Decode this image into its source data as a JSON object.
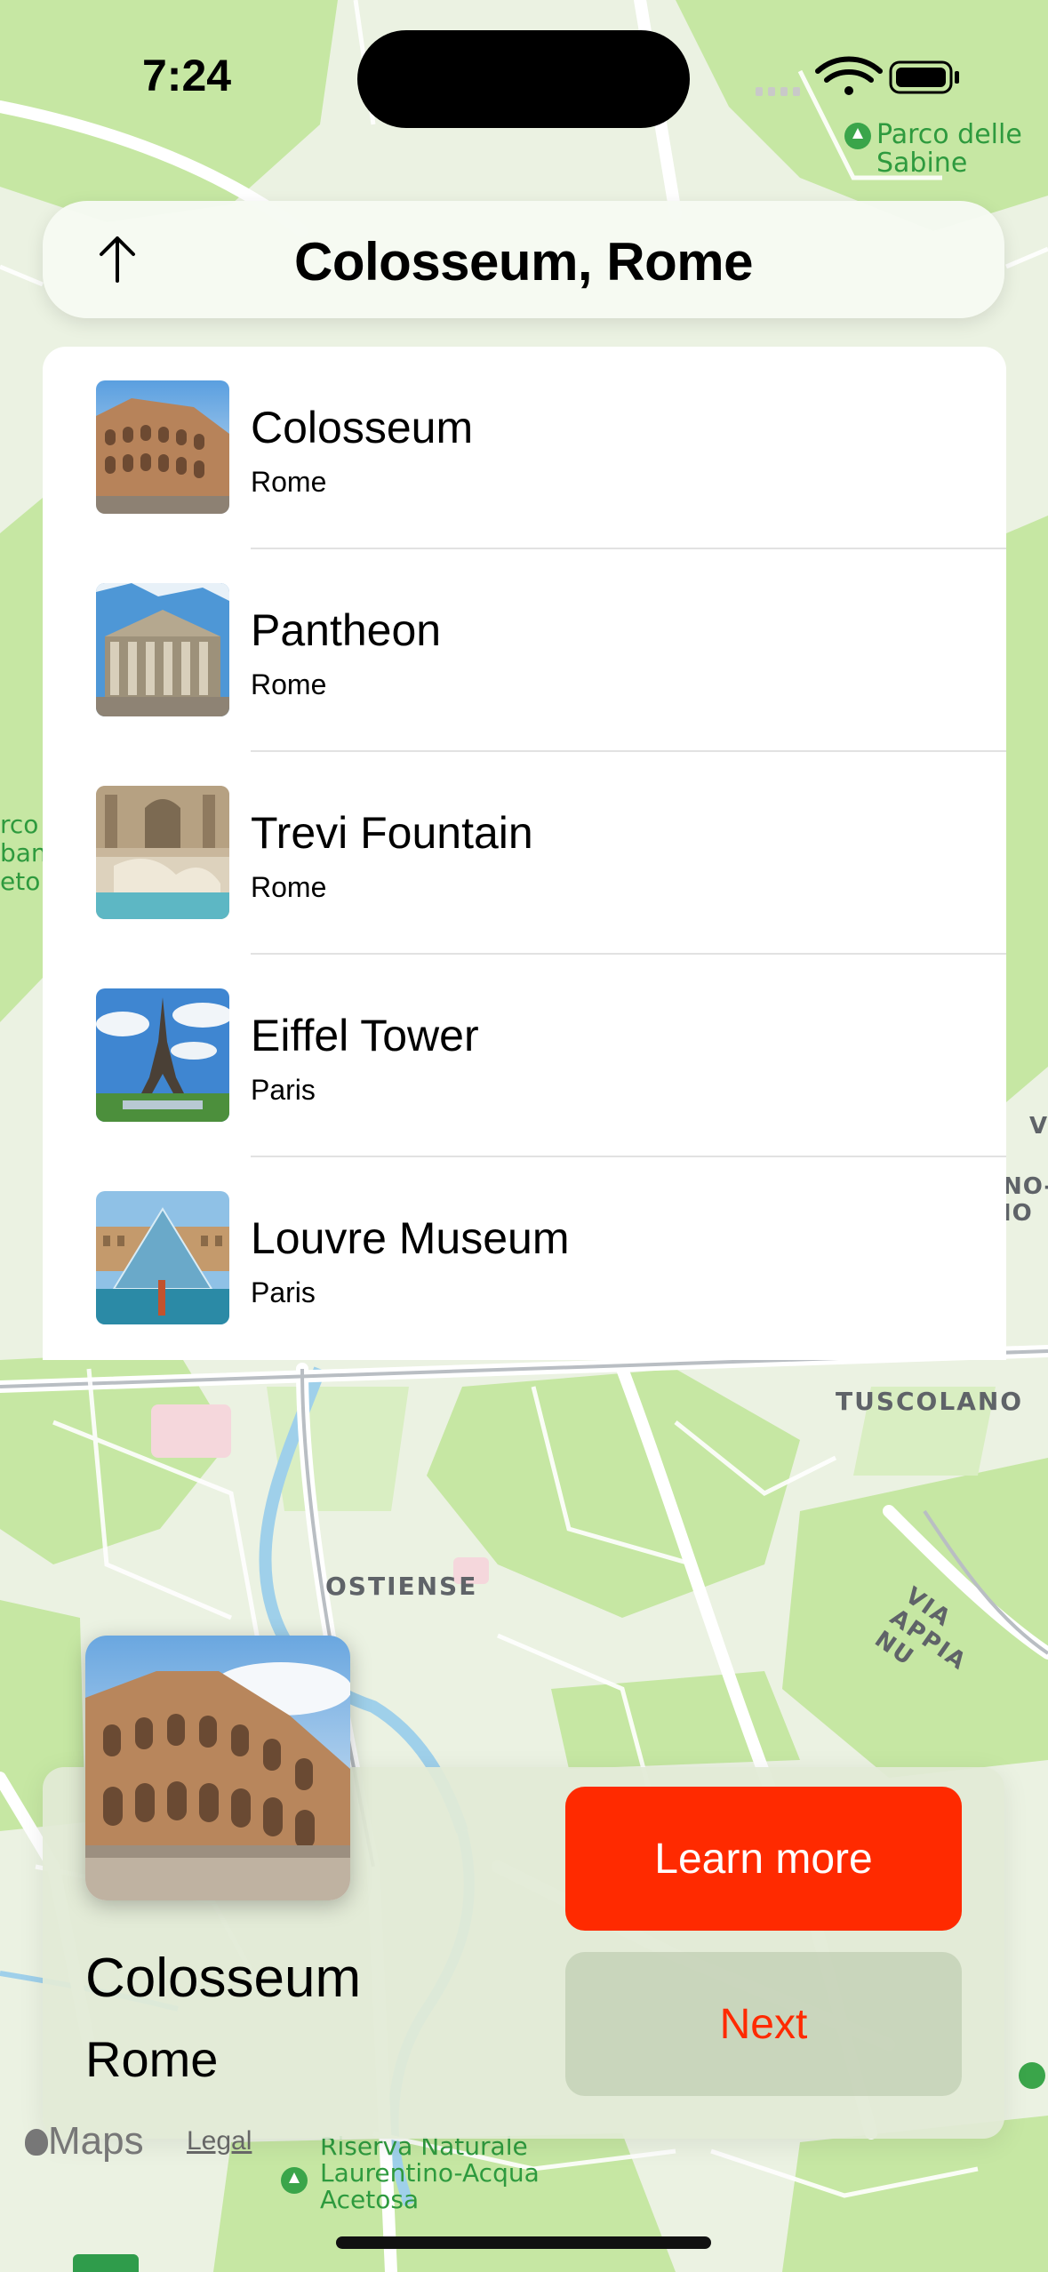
{
  "status_bar": {
    "time": "7:24"
  },
  "header": {
    "title": "Colosseum, Rome",
    "back_icon": "arrow-up-icon"
  },
  "places": [
    {
      "name": "Colosseum",
      "city": "Rome"
    },
    {
      "name": "Pantheon",
      "city": "Rome"
    },
    {
      "name": "Trevi Fountain",
      "city": "Rome"
    },
    {
      "name": "Eiffel Tower",
      "city": "Paris"
    },
    {
      "name": "Louvre Museum",
      "city": "Paris"
    }
  ],
  "map": {
    "labels": {
      "tuscolano": "TUSCOLANO",
      "ostiense": "OSTIENSE",
      "via_appia": "VIA APPIA NU",
      "parco": "Parco delle\nSabine",
      "riserva": "Riserva Naturale\nLaurentino-Acqua\nAcetosa",
      "left_edge": "rco\nban\neto",
      "right_edge": "NO-\nIO",
      "right_v": "V"
    },
    "colors": {
      "land": "#e9f1df",
      "park": "#c3e59f",
      "water": "#9fd0ea",
      "road": "#ffffff"
    }
  },
  "card": {
    "title": "Colosseum",
    "subtitle": "Rome",
    "learn_more": "Learn more",
    "next": "Next"
  },
  "footer": {
    "maps": "Maps",
    "legal": "Legal"
  },
  "colors": {
    "accent": "#ff2a00"
  }
}
